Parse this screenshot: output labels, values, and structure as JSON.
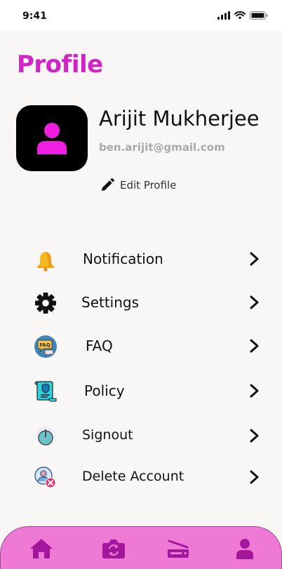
{
  "status_bar": {
    "time": "9:41"
  },
  "header": {
    "title": "Profile"
  },
  "profile": {
    "name": "Arijit Mukherjee",
    "email": "ben.arijit@gmail.com",
    "edit_label": "Edit Profile"
  },
  "menu": {
    "items": [
      {
        "label": "Notification",
        "icon": "bell-icon"
      },
      {
        "label": "Settings",
        "icon": "gear-icon"
      },
      {
        "label": "FAQ",
        "icon": "faq-icon"
      },
      {
        "label": "Policy",
        "icon": "policy-icon"
      },
      {
        "label": "Signout",
        "icon": "power-icon"
      },
      {
        "label": "Delete Account",
        "icon": "delete-account-icon"
      }
    ]
  },
  "bottom_nav": {
    "items": [
      {
        "icon": "home-icon"
      },
      {
        "icon": "camera-icon"
      },
      {
        "icon": "scanner-icon"
      },
      {
        "icon": "person-icon"
      }
    ]
  },
  "colors": {
    "accent": "#d223c6",
    "nav_background": "#ee7ad6",
    "nav_icon": "#a3179a",
    "background": "#f9f7f6"
  }
}
